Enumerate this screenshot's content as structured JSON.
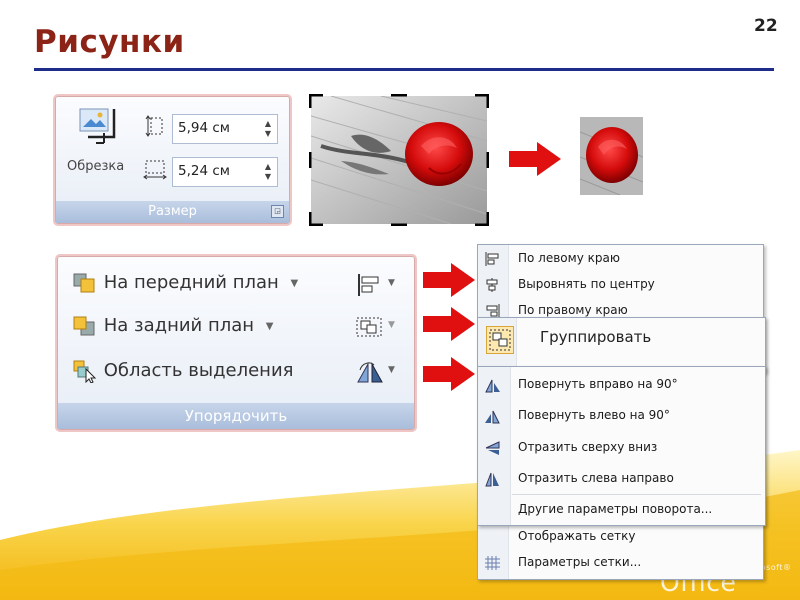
{
  "slide": {
    "title": "Рисунки",
    "number": "22"
  },
  "size_panel": {
    "footer": "Размер",
    "crop_label": "Обрезка",
    "height_value": "5,94 см",
    "width_value": "5,24 см"
  },
  "arrange_panel": {
    "footer": "Упорядочить",
    "bring_forward": "На передний план",
    "send_backward": "На задний план",
    "selection_pane": "Область выделения"
  },
  "align_menu": {
    "items": [
      "По левому краю",
      "Выровнять по центру",
      "По правому краю"
    ],
    "bottom_items": [
      "Отображать сетку",
      "Параметры сетки..."
    ]
  },
  "group_menu": {
    "label": "Группировать"
  },
  "rotate_menu": {
    "items": [
      "Повернуть вправо на 90°",
      "Повернуть влево на 90°",
      "Отразить сверху вниз",
      "Отразить слева направо"
    ],
    "more": "Другие параметры поворота..."
  },
  "branding": {
    "logo": "Office",
    "trademark": "Microsoft®"
  },
  "colors": {
    "title": "#8b2316",
    "rule": "#1e2d8a",
    "arrow": "#e01010",
    "swoosh": "#f5c21a"
  }
}
